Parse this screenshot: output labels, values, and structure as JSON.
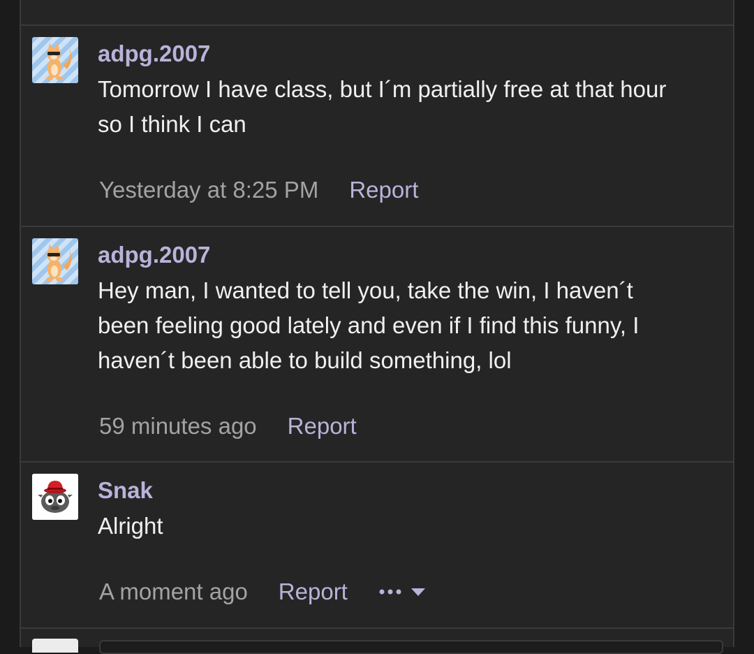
{
  "comments": [
    {
      "username": "adpg.2007",
      "lines": [
        "Tomorrow I have class, but I´m partially free at that hour",
        "so I think I can"
      ],
      "timestamp": "Yesterday at 8:25 PM",
      "report_label": "Report",
      "avatar_icon": "orange-cat-avatar-icon"
    },
    {
      "username": "adpg.2007",
      "lines": [
        "Hey man, I wanted to tell you, take the win, I haven´t",
        "been feeling good lately and even if I find this funny, I",
        "haven´t been able to build something, lol"
      ],
      "timestamp": "59 minutes ago",
      "report_label": "Report",
      "avatar_icon": "orange-cat-avatar-icon"
    },
    {
      "username": "Snak",
      "lines": [
        "Alright"
      ],
      "timestamp": "A moment ago",
      "report_label": "Report",
      "avatar_icon": "gray-puffle-red-hat-avatar-icon",
      "more_icon": "ellipsis-icon",
      "dropdown_icon": "caret-down-icon"
    }
  ],
  "colors": {
    "background": "#1b1b1c",
    "panel": "#252526",
    "username": "#b9b3d9",
    "link": "#b9b3d9",
    "text": "#f0f0f0",
    "muted": "#a3a3a3"
  }
}
